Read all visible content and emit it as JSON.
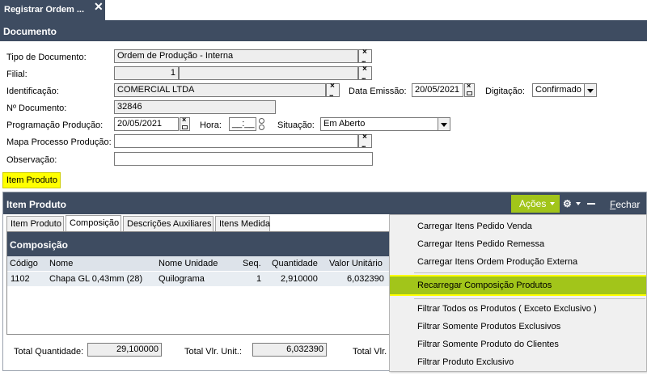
{
  "tab": {
    "title": "Registrar Ordem ...",
    "close": "✕"
  },
  "header": {
    "title": "Documento"
  },
  "form": {
    "tipo_label": "Tipo de Documento:",
    "tipo_value": "Ordem de Produção - Interna",
    "filial_label": "Filial:",
    "filial_value": "1",
    "ident_label": "Identificação:",
    "ident_value": "COMERCIAL LTDA",
    "data_emissao_label": "Data Emissão:",
    "data_emissao_value": "20/05/2021",
    "digitacao_label": "Digitação:",
    "digitacao_value": "Confirmado",
    "ndoc_label": "Nº Documento:",
    "ndoc_value": "32846",
    "prog_label": "Programação Produção:",
    "prog_value": "20/05/2021",
    "hora_label": "Hora:",
    "hora_value": "__:__",
    "situacao_label": "Situação:",
    "situacao_value": "Em Aberto",
    "mapa_label": "Mapa Processo Produção:",
    "mapa_value": "",
    "obs_label": "Observação:",
    "obs_value": ""
  },
  "section_tab": "Item Produto",
  "panel": {
    "title": "Item Produto",
    "acoes": "Ações",
    "fechar_u": "F",
    "fechar_rest": "echar",
    "subtabs": [
      "Item Produto",
      "Composição",
      "Descrições Auxiliares",
      "Itens Medida"
    ],
    "composicao": {
      "title": "Composição",
      "columns": [
        "Código",
        "Nome",
        "Nome Unidade",
        "Seq.",
        "Quantidade",
        "Valor Unitário"
      ],
      "rows": [
        {
          "codigo": "1102",
          "nome": "Chapa GL 0,43mm (28)",
          "unidade": "Quilograma",
          "seq": "1",
          "quantidade": "2,910000",
          "valor": "6,032390"
        }
      ]
    },
    "totals": {
      "qtd_label": "Total Quantidade:",
      "qtd_value": "29,100000",
      "vlr_unit_label": "Total Vlr. Unit.:",
      "vlr_unit_value": "6,032390",
      "vlr_label": "Total Vlr."
    }
  },
  "menu": {
    "items": [
      "Carregar Itens Pedido Venda",
      "Carregar Itens Pedido Remessa",
      "Carregar Itens Ordem Produção Externa",
      "Recarregar Composição Produtos",
      "Filtrar Todos os Produtos ( Exceto Exclusivo )",
      "Filtrar Somente Produtos Exclusivos",
      "Filtrar Somente Produto do Clientes",
      "Filtrar Produto Exclusivo"
    ]
  },
  "colors": {
    "header": "#3e4c61",
    "accent": "#a2c51a",
    "highlight": "#ffff00"
  }
}
